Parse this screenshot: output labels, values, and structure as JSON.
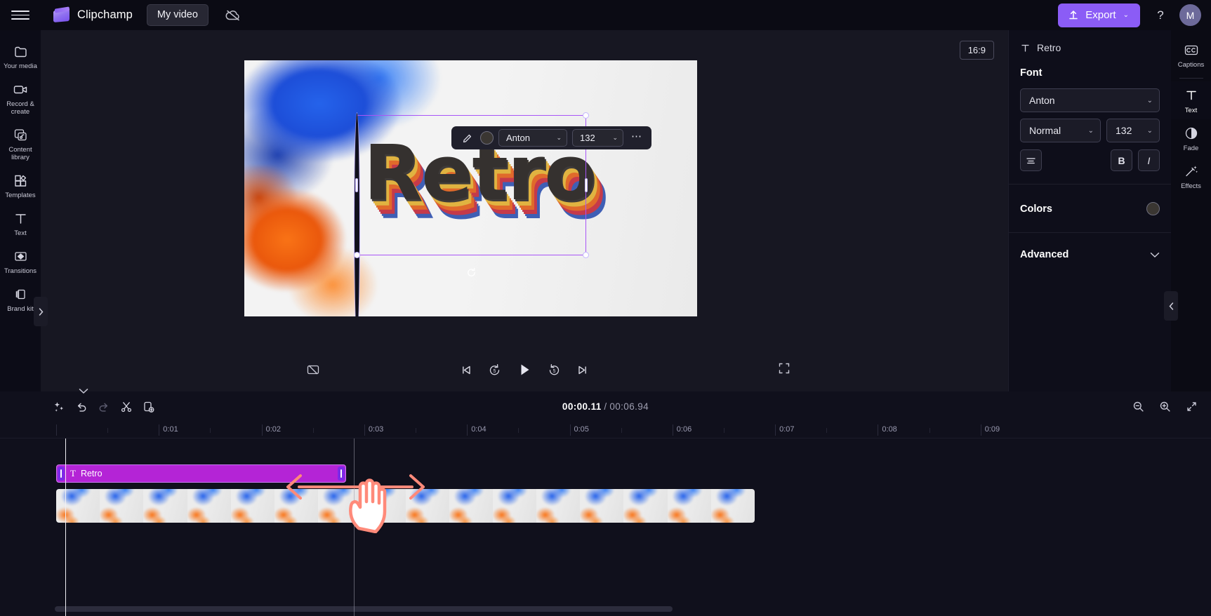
{
  "header": {
    "menu_icon": "hamburger-icon",
    "brand": "Clipchamp",
    "project_tab": "My video",
    "cloud_icon": "cloud-off-icon",
    "export_label": "Export",
    "export_icon": "upload-icon",
    "export_chevron": "⌄",
    "export_color": "#8b5cf6",
    "help_label": "?",
    "avatar_initial": "M"
  },
  "sidebar": {
    "items": [
      {
        "label": "Your media",
        "icon": "media-folder-icon"
      },
      {
        "label": "Record & create",
        "icon": "video-camera-icon"
      },
      {
        "label": "Content library",
        "icon": "content-library-icon"
      },
      {
        "label": "Templates",
        "icon": "templates-grid-icon"
      },
      {
        "label": "Text",
        "icon": "text-t-icon"
      },
      {
        "label": "Transitions",
        "icon": "transitions-icon"
      },
      {
        "label": "Brand kit",
        "icon": "brand-kit-icon"
      }
    ],
    "collapse_icon": "chevron-right-icon"
  },
  "stage": {
    "aspect_ratio": "16:9",
    "preview_text": "Retro",
    "rotate_icon": "rotate-handle-icon",
    "text_toolbar": {
      "edit_icon": "pencil-icon",
      "color_swatch": "#3a3632",
      "font": "Anton",
      "size": "132",
      "more_icon": "ellipsis-icon",
      "chevron": "⌄"
    }
  },
  "playback": {
    "captions_off_icon": "captions-off-icon",
    "skip_start_icon": "skip-to-start-icon",
    "rewind_label": "5",
    "rewind_icon": "rewind-5-icon",
    "play_icon": "play-icon",
    "forward_label": "5",
    "forward_icon": "forward-5-icon",
    "skip_end_icon": "skip-to-end-icon",
    "fullscreen_icon": "fullscreen-icon"
  },
  "properties": {
    "title": "Retro",
    "title_icon": "text-t-icon",
    "font_section": "Font",
    "font_family": "Anton",
    "font_style": "Normal",
    "font_size": "132",
    "align_icon": "align-center-icon",
    "bold_label": "B",
    "italic_label": "I",
    "colors_section": "Colors",
    "color_value": "#3a3632",
    "advanced_section": "Advanced",
    "chevron": "⌄"
  },
  "right_rail": {
    "items": [
      {
        "label": "Captions",
        "icon": "closed-captions-icon",
        "active": false
      },
      {
        "label": "Text",
        "icon": "text-t-icon",
        "active": true
      },
      {
        "label": "Fade",
        "icon": "fade-circle-icon",
        "active": false
      },
      {
        "label": "Effects",
        "icon": "magic-wand-effects-icon",
        "active": false
      }
    ],
    "collapse_icon": "chevron-left-icon"
  },
  "timeline": {
    "collapse_icon": "chevron-down-icon",
    "tools": [
      {
        "name": "auto-compose-button",
        "icon": "sparkle-icon",
        "dim": false
      },
      {
        "name": "undo-button",
        "icon": "undo-icon",
        "dim": false
      },
      {
        "name": "redo-button",
        "icon": "redo-icon",
        "dim": true
      },
      {
        "name": "split-button",
        "icon": "scissors-icon",
        "dim": false
      },
      {
        "name": "duplicate-button",
        "icon": "duplicate-icon",
        "dim": false
      }
    ],
    "current_time": "00:00.11",
    "separator": "/",
    "total_time": "00:06.94",
    "zoom_out_icon": "zoom-out-icon",
    "zoom_in_icon": "zoom-in-icon",
    "fit_icon": "fit-to-screen-icon",
    "ruler_labels": [
      "0:01",
      "0:02",
      "0:03",
      "0:04",
      "0:05",
      "0:06",
      "0:07",
      "0:08",
      "0:09"
    ],
    "text_clip": {
      "label": "Retro",
      "icon": "text-t-icon",
      "color": "#b424d6"
    },
    "video_clip": {
      "name": "video-clip-thumbnails"
    },
    "annotation_arrow": "double-arrow-annotation",
    "annotation_hand": "hand-cursor-annotation",
    "annotation_color": "#ff8a7a"
  }
}
